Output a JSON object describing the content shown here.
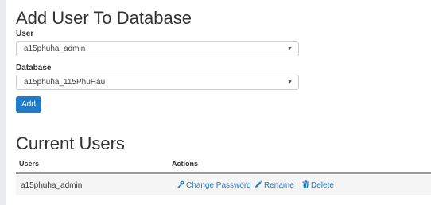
{
  "add_user": {
    "title": "Add User To Database",
    "user_label": "User",
    "user_value": "a15phuha_admin",
    "database_label": "Database",
    "database_value": "a15phuha_115PhuHau",
    "add_button": "Add"
  },
  "current_users": {
    "title": "Current Users",
    "columns": [
      "Users",
      "Actions"
    ],
    "rows": [
      {
        "user": "a15phuha_admin",
        "actions": {
          "change_password": "Change Password",
          "rename": "Rename",
          "delete": "Delete"
        }
      }
    ]
  },
  "icons": {
    "select_arrow": "chevron-down-icon",
    "change_password": "key-icon",
    "rename": "pencil-icon",
    "delete": "trash-icon"
  },
  "colors": {
    "primary_button": "#1f7ac8",
    "link": "#2a79c4",
    "row_background": "#f5f5f5"
  }
}
